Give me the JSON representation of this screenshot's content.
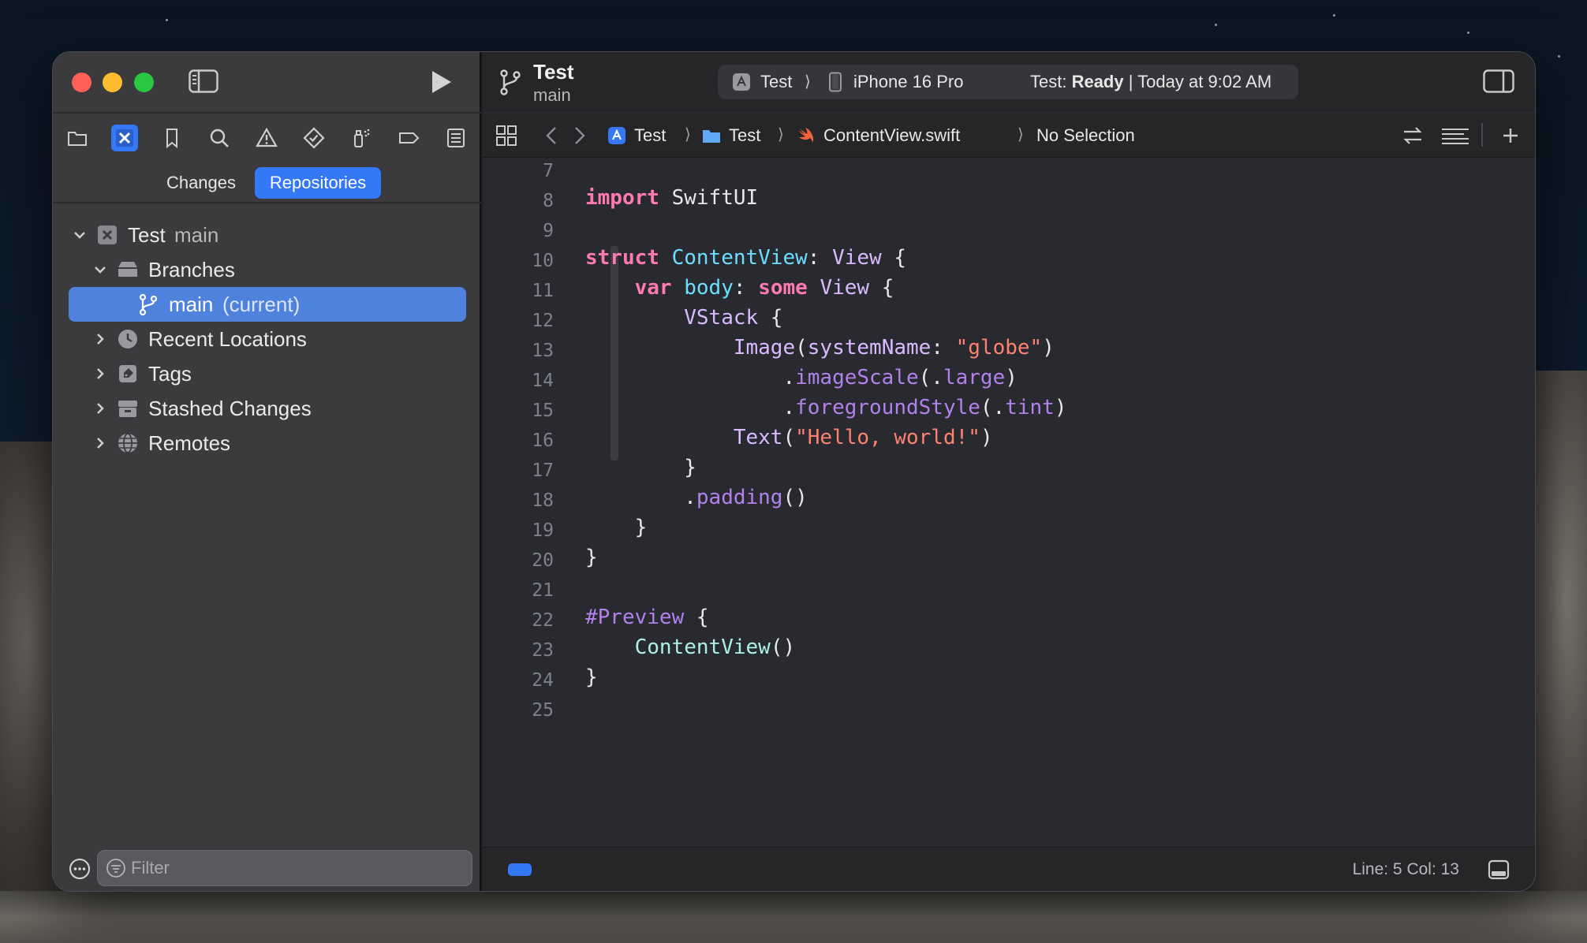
{
  "sidebar": {
    "nav_icons": [
      "folder-icon",
      "source-control-icon",
      "bookmark-icon",
      "search-icon",
      "warning-icon",
      "test-diamond-icon",
      "debug-spray-icon",
      "breakpoint-tag-icon",
      "report-icon"
    ],
    "segments": {
      "changes": "Changes",
      "repositories": "Repositories"
    },
    "tree": {
      "repo_name": "Test",
      "repo_branch": "main",
      "branches": "Branches",
      "current_branch": "main",
      "current_suffix": "(current)",
      "recent_locations": "Recent Locations",
      "tags": "Tags",
      "stashed_changes": "Stashed Changes",
      "remotes": "Remotes"
    },
    "filter_placeholder": "Filter"
  },
  "toolbar": {
    "project_title": "Test",
    "project_branch": "main",
    "scheme_name": "Test",
    "scheme_chevron": "⟩",
    "device": "iPhone 16 Pro",
    "status_prefix": "Test: ",
    "status_state": "Ready",
    "status_suffix": " | Today at 9:02 AM"
  },
  "jumpbar": {
    "crumb_project": "Test",
    "crumb_folder": "Test",
    "crumb_file": "ContentView.swift",
    "crumb_selection": "No Selection",
    "separator": "⟩"
  },
  "editor": {
    "line_numbers": [
      "7",
      "8",
      "9",
      "10",
      "11",
      "12",
      "13",
      "14",
      "15",
      "16",
      "17",
      "18",
      "19",
      "20",
      "21",
      "22",
      "23",
      "24",
      "25"
    ],
    "code": {
      "l8_kw": "import",
      "l8_mod": " SwiftUI",
      "l10_kw": "struct",
      "l10_name": " ContentView",
      "l10_colon": ": ",
      "l10_type": "View",
      "l10_brace": " {",
      "l11_indent": "    ",
      "l11_kw": "var",
      "l11_name": " body",
      "l11_colon": ": ",
      "l11_kw2": "some",
      "l11_type": " View",
      "l11_brace": " {",
      "l12_indent": "        ",
      "l12_type": "VStack",
      "l12_brace": " {",
      "l13_indent": "            ",
      "l13_type": "Image",
      "l13_open": "(",
      "l13_param": "systemName",
      "l13_colon": ": ",
      "l13_str": "\"globe\"",
      "l13_close": ")",
      "l14_indent": "                ",
      "l14_dot": ".",
      "l14_fn": "imageScale",
      "l14_open": "(.",
      "l14_arg": "large",
      "l14_close": ")",
      "l15_indent": "                ",
      "l15_dot": ".",
      "l15_fn": "foregroundStyle",
      "l15_open": "(.",
      "l15_arg": "tint",
      "l15_close": ")",
      "l16_indent": "            ",
      "l16_type": "Text",
      "l16_open": "(",
      "l16_str": "\"Hello, world!\"",
      "l16_close": ")",
      "l17": "        }",
      "l18_indent": "        ",
      "l18_dot": ".",
      "l18_fn": "padding",
      "l18_call": "()",
      "l19": "    }",
      "l20": "}",
      "l22_pp": "#Preview",
      "l22_brace": " {",
      "l23_indent": "    ",
      "l23_name": "ContentView",
      "l23_call": "()",
      "l24": "}"
    }
  },
  "statusbar": {
    "line_col": "Line: 5  Col: 13"
  },
  "colors": {
    "accent": "#3478f6",
    "keyword": "#ff7ab2",
    "string": "#ff8170",
    "type": "#dabaff",
    "declared_type": "#6bdfff"
  }
}
